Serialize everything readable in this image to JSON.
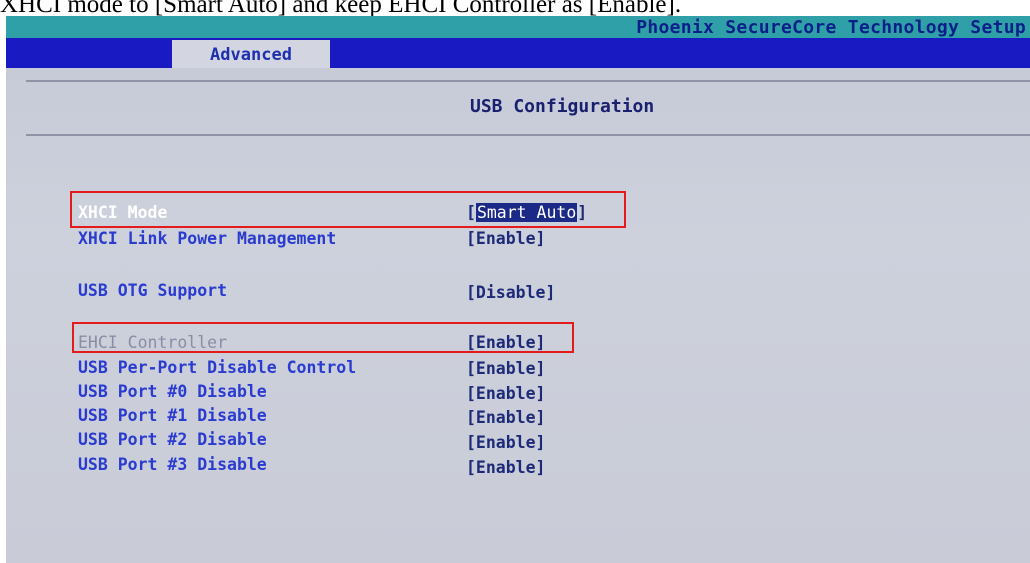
{
  "caption": "XHCI mode to [Smart Auto] and keep EHCI Controller as [Enable].",
  "vendor": "Phoenix SecureCore Technology Setup",
  "tabs": [
    {
      "label": "Advanced",
      "active": true
    }
  ],
  "page_title": "USB Configuration",
  "items": [
    {
      "label": "XHCI Mode",
      "value": "Smart Auto",
      "selected": true
    },
    {
      "label": "XHCI Link Power Management",
      "value": "[Enable]"
    },
    {
      "label": "USB OTG Support",
      "value": "[Disable]"
    },
    {
      "label": "EHCI Controller",
      "value": "[Enable]",
      "grayed": true
    },
    {
      "label": "USB Per-Port Disable Control",
      "value": "[Enable]"
    },
    {
      "label": "USB Port #0 Disable",
      "value": "[Enable]"
    },
    {
      "label": "USB Port #1 Disable",
      "value": "[Enable]"
    },
    {
      "label": "USB Port #2 Disable",
      "value": "[Enable]"
    },
    {
      "label": "USB Port #3 Disable",
      "value": "[Enable]"
    }
  ],
  "colors": {
    "top_bar": "#2fa0a8",
    "tab_bar": "#1a1ac2",
    "panel_bg": "#c9ccd7",
    "item_text": "#2a3bd0",
    "value_text": "#1c2a78",
    "highlight_box": "#e51a1a"
  }
}
